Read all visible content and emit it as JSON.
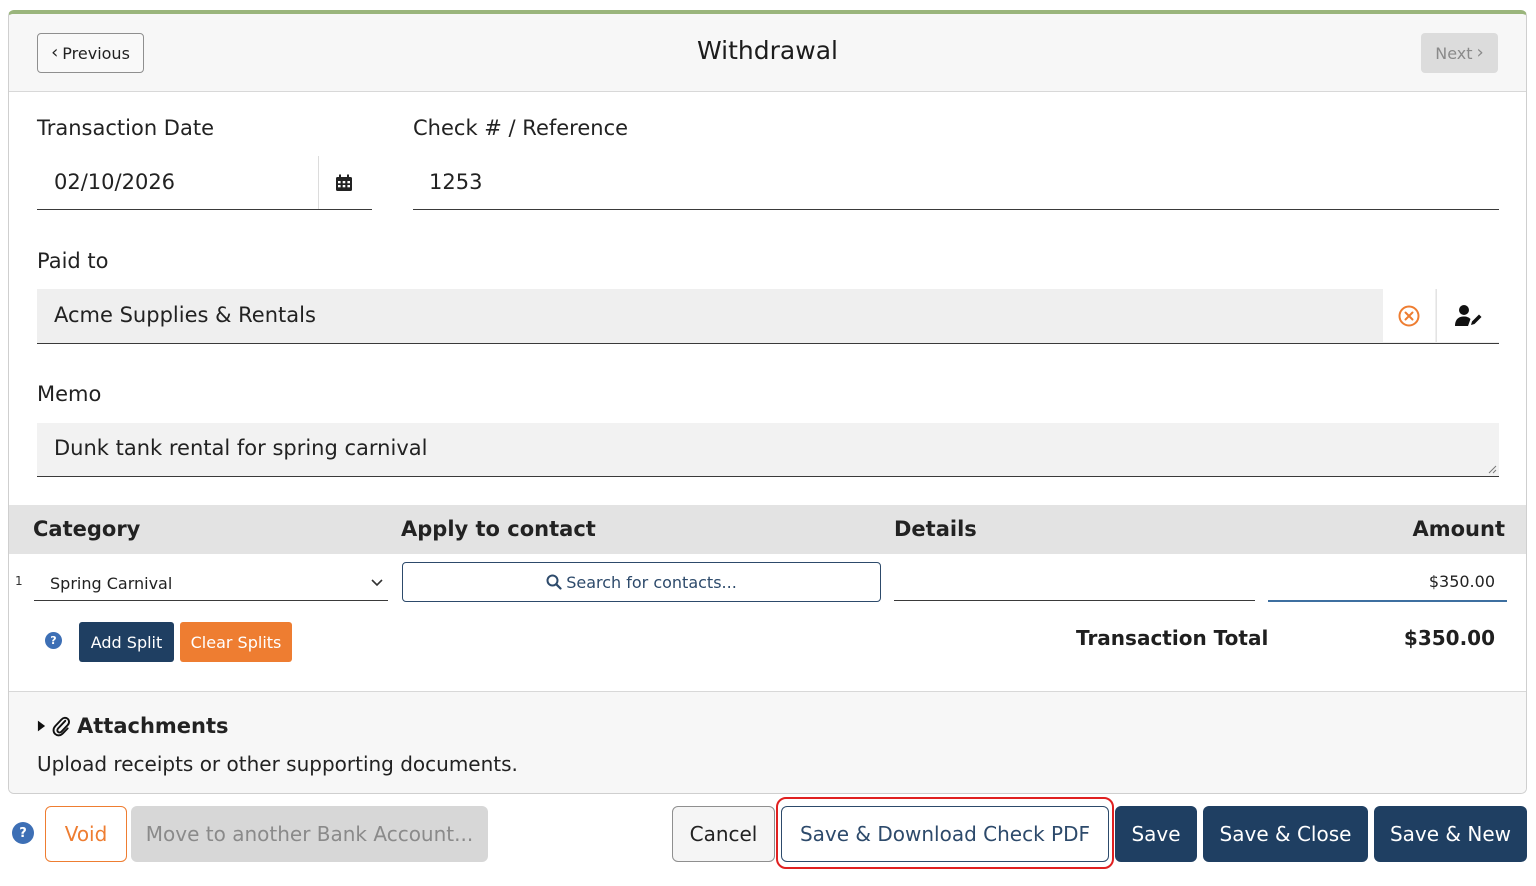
{
  "header": {
    "title": "Withdrawal",
    "previous_label": "Previous",
    "next_label": "Next"
  },
  "form": {
    "transaction_date_label": "Transaction Date",
    "transaction_date_value": "02/10/2026",
    "check_ref_label": "Check # / Reference",
    "check_ref_value": "1253",
    "paid_to_label": "Paid to",
    "paid_to_value": "Acme Supplies & Rentals",
    "memo_label": "Memo",
    "memo_value": "Dunk tank rental for spring carnival"
  },
  "splits": {
    "columns": {
      "category": "Category",
      "apply_to_contact": "Apply to contact",
      "details": "Details",
      "amount": "Amount"
    },
    "rows": [
      {
        "index": "1",
        "category": "Spring Carnival",
        "contact_search_label": "Search for contacts...",
        "details": "",
        "amount": "$350.00"
      }
    ],
    "help_icon": "?",
    "add_split_label": "Add Split",
    "clear_splits_label": "Clear Splits",
    "total_label": "Transaction Total",
    "total_value": "$350.00"
  },
  "attachments": {
    "title": "Attachments",
    "description": "Upload receipts or other supporting documents."
  },
  "footer": {
    "help_icon": "?",
    "void_label": "Void",
    "move_label": "Move to another Bank Account...",
    "cancel_label": "Cancel",
    "save_pdf_label": "Save & Download Check PDF",
    "save_label": "Save",
    "save_close_label": "Save & Close",
    "save_new_label": "Save & New"
  },
  "colors": {
    "primary_dark": "#1f3f62",
    "accent_orange": "#ee7d31",
    "highlight_red": "#e02020",
    "top_border_green": "#9ab57c"
  }
}
